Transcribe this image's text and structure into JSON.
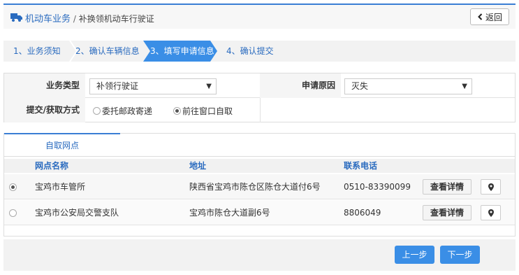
{
  "header": {
    "title": "机动车业务",
    "separator": " / ",
    "subtitle": "补换领机动车行驶证",
    "back_label": "返回",
    "accent": "#3a7ed4"
  },
  "steps": [
    {
      "label": "1、业务须知",
      "active": false
    },
    {
      "label": "2、确认车辆信息",
      "active": false
    },
    {
      "label": "3、填写申请信息",
      "active": true
    },
    {
      "label": "4、确认提交",
      "active": false
    }
  ],
  "form": {
    "business_type_label": "业务类型",
    "business_type_value": "补领行驶证",
    "reason_label": "申请原因",
    "reason_value": "灭失",
    "delivery_label": "提交/获取方式",
    "delivery_options": [
      {
        "label": "委托邮政寄递",
        "selected": false
      },
      {
        "label": "前往窗口自取",
        "selected": true
      }
    ]
  },
  "pickup": {
    "tab_label": "自取网点",
    "columns": [
      "网点名称",
      "地址",
      "联系电话"
    ],
    "rows": [
      {
        "name": "宝鸡市车管所",
        "address": "陕西省宝鸡市陈仓区陈仓大道付6号",
        "phone": "0510-83390099",
        "detail_label": "查看详情",
        "selected": true
      },
      {
        "name": "宝鸡市公安局交警支队",
        "address": "宝鸡市陈仓大道副6号",
        "phone": "8806049",
        "detail_label": "查看详情",
        "selected": false
      }
    ]
  },
  "footer": {
    "prev_label": "上一步",
    "next_label": "下一步",
    "button_color": "#3a8ee6"
  },
  "icons": {
    "truck": "truck-icon",
    "back": "chevron-left-icon",
    "map_pin": "map-pin-icon",
    "dropdown": "caret-down-icon"
  }
}
